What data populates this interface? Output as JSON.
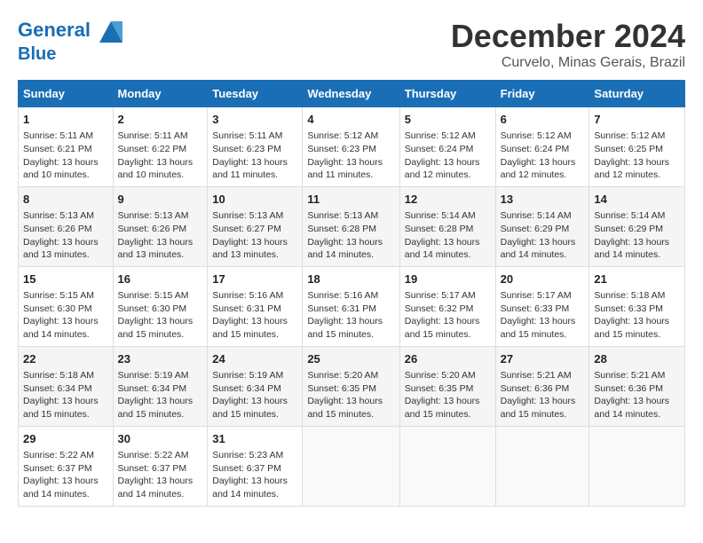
{
  "logo": {
    "line1": "General",
    "line2": "Blue"
  },
  "title": "December 2024",
  "subtitle": "Curvelo, Minas Gerais, Brazil",
  "days_of_week": [
    "Sunday",
    "Monday",
    "Tuesday",
    "Wednesday",
    "Thursday",
    "Friday",
    "Saturday"
  ],
  "weeks": [
    [
      {
        "day": "1",
        "sunrise": "5:11 AM",
        "sunset": "6:21 PM",
        "daylight": "13 hours and 10 minutes."
      },
      {
        "day": "2",
        "sunrise": "5:11 AM",
        "sunset": "6:22 PM",
        "daylight": "13 hours and 10 minutes."
      },
      {
        "day": "3",
        "sunrise": "5:11 AM",
        "sunset": "6:23 PM",
        "daylight": "13 hours and 11 minutes."
      },
      {
        "day": "4",
        "sunrise": "5:12 AM",
        "sunset": "6:23 PM",
        "daylight": "13 hours and 11 minutes."
      },
      {
        "day": "5",
        "sunrise": "5:12 AM",
        "sunset": "6:24 PM",
        "daylight": "13 hours and 12 minutes."
      },
      {
        "day": "6",
        "sunrise": "5:12 AM",
        "sunset": "6:24 PM",
        "daylight": "13 hours and 12 minutes."
      },
      {
        "day": "7",
        "sunrise": "5:12 AM",
        "sunset": "6:25 PM",
        "daylight": "13 hours and 12 minutes."
      }
    ],
    [
      {
        "day": "8",
        "sunrise": "5:13 AM",
        "sunset": "6:26 PM",
        "daylight": "13 hours and 13 minutes."
      },
      {
        "day": "9",
        "sunrise": "5:13 AM",
        "sunset": "6:26 PM",
        "daylight": "13 hours and 13 minutes."
      },
      {
        "day": "10",
        "sunrise": "5:13 AM",
        "sunset": "6:27 PM",
        "daylight": "13 hours and 13 minutes."
      },
      {
        "day": "11",
        "sunrise": "5:13 AM",
        "sunset": "6:28 PM",
        "daylight": "13 hours and 14 minutes."
      },
      {
        "day": "12",
        "sunrise": "5:14 AM",
        "sunset": "6:28 PM",
        "daylight": "13 hours and 14 minutes."
      },
      {
        "day": "13",
        "sunrise": "5:14 AM",
        "sunset": "6:29 PM",
        "daylight": "13 hours and 14 minutes."
      },
      {
        "day": "14",
        "sunrise": "5:14 AM",
        "sunset": "6:29 PM",
        "daylight": "13 hours and 14 minutes."
      }
    ],
    [
      {
        "day": "15",
        "sunrise": "5:15 AM",
        "sunset": "6:30 PM",
        "daylight": "13 hours and 14 minutes."
      },
      {
        "day": "16",
        "sunrise": "5:15 AM",
        "sunset": "6:30 PM",
        "daylight": "13 hours and 15 minutes."
      },
      {
        "day": "17",
        "sunrise": "5:16 AM",
        "sunset": "6:31 PM",
        "daylight": "13 hours and 15 minutes."
      },
      {
        "day": "18",
        "sunrise": "5:16 AM",
        "sunset": "6:31 PM",
        "daylight": "13 hours and 15 minutes."
      },
      {
        "day": "19",
        "sunrise": "5:17 AM",
        "sunset": "6:32 PM",
        "daylight": "13 hours and 15 minutes."
      },
      {
        "day": "20",
        "sunrise": "5:17 AM",
        "sunset": "6:33 PM",
        "daylight": "13 hours and 15 minutes."
      },
      {
        "day": "21",
        "sunrise": "5:18 AM",
        "sunset": "6:33 PM",
        "daylight": "13 hours and 15 minutes."
      }
    ],
    [
      {
        "day": "22",
        "sunrise": "5:18 AM",
        "sunset": "6:34 PM",
        "daylight": "13 hours and 15 minutes."
      },
      {
        "day": "23",
        "sunrise": "5:19 AM",
        "sunset": "6:34 PM",
        "daylight": "13 hours and 15 minutes."
      },
      {
        "day": "24",
        "sunrise": "5:19 AM",
        "sunset": "6:34 PM",
        "daylight": "13 hours and 15 minutes."
      },
      {
        "day": "25",
        "sunrise": "5:20 AM",
        "sunset": "6:35 PM",
        "daylight": "13 hours and 15 minutes."
      },
      {
        "day": "26",
        "sunrise": "5:20 AM",
        "sunset": "6:35 PM",
        "daylight": "13 hours and 15 minutes."
      },
      {
        "day": "27",
        "sunrise": "5:21 AM",
        "sunset": "6:36 PM",
        "daylight": "13 hours and 15 minutes."
      },
      {
        "day": "28",
        "sunrise": "5:21 AM",
        "sunset": "6:36 PM",
        "daylight": "13 hours and 14 minutes."
      }
    ],
    [
      {
        "day": "29",
        "sunrise": "5:22 AM",
        "sunset": "6:37 PM",
        "daylight": "13 hours and 14 minutes."
      },
      {
        "day": "30",
        "sunrise": "5:22 AM",
        "sunset": "6:37 PM",
        "daylight": "13 hours and 14 minutes."
      },
      {
        "day": "31",
        "sunrise": "5:23 AM",
        "sunset": "6:37 PM",
        "daylight": "13 hours and 14 minutes."
      },
      null,
      null,
      null,
      null
    ]
  ]
}
